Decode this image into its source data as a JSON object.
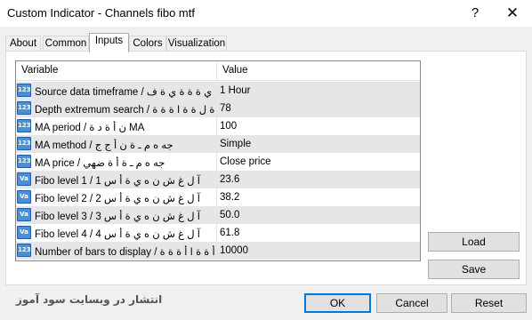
{
  "window": {
    "title": "Custom Indicator - Channels fibo mtf",
    "help_glyph": "?",
    "close_glyph": "✕"
  },
  "tabs": [
    {
      "label": "About"
    },
    {
      "label": "Common"
    },
    {
      "label": "Inputs",
      "active": true
    },
    {
      "label": "Colors"
    },
    {
      "label": "Visualization"
    }
  ],
  "grid": {
    "headers": {
      "variable": "Variable",
      "value": "Value"
    },
    "rows": [
      {
        "icon": "123",
        "variable": "Source data timeframe / ن أ ِ ي ة ة ة ي ة ف",
        "value": "1 Hour"
      },
      {
        "icon": "123",
        "variable": "Depth extremum search / ة ة ل ة ة ا ة ة ة...",
        "value": "78"
      },
      {
        "icon": "123",
        "variable": "MA period / ن أ ة د ة  MA",
        "value": "100"
      },
      {
        "icon": "123",
        "variable": "MA method / جه ه م ـ ة ن أ ج ج",
        "value": "Simple"
      },
      {
        "icon": "123",
        "variable": "MA price / جه ه م ـ ة أ ة ضهي",
        "value": "Close price"
      },
      {
        "icon": "Va",
        "variable": "Fibo level 1 / آ ل غ ش ن ه ي ة أ س 1",
        "value": "23.6"
      },
      {
        "icon": "Va",
        "variable": "Fibo level 2 / آ ل غ ش ن ه ي ة أ س 2",
        "value": "38.2"
      },
      {
        "icon": "Va",
        "variable": "Fibo level 3 / آ ل غ ش ن ه ي ة أ س 3",
        "value": "50.0"
      },
      {
        "icon": "Va",
        "variable": "Fibo level 4 / آ ل غ ش ن ه ي ة أ س 4",
        "value": "61.8"
      },
      {
        "icon": "123",
        "variable": "Number of bars to display / أ ة ة ا أ ة ة ة ...",
        "value": "10000"
      }
    ]
  },
  "side_buttons": {
    "load": "Load",
    "save": "Save"
  },
  "bottom_buttons": {
    "ok": "OK",
    "cancel": "Cancel",
    "reset": "Reset"
  },
  "watermark": "انتشار در وبسایت سود آموز",
  "colors": {
    "row_alt": "#e6e6e6",
    "icon_blue": "#4a90d9",
    "default_button_border": "#0078d7"
  }
}
